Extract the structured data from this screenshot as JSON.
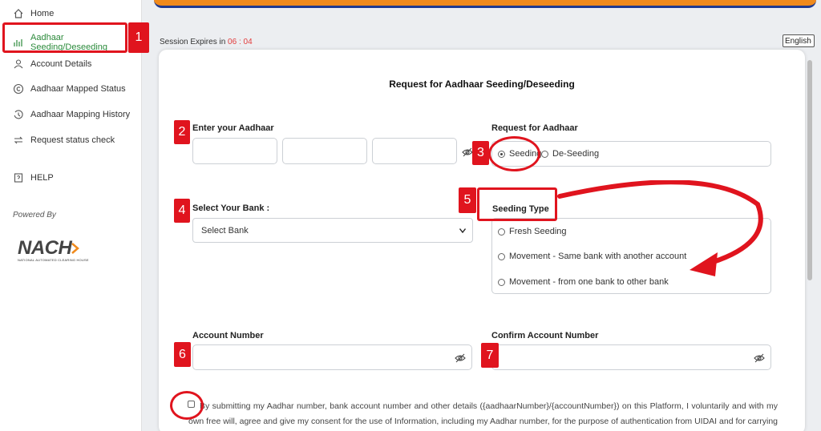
{
  "sidebar": {
    "items": [
      {
        "label": "Home",
        "icon": "home-icon"
      },
      {
        "label": "Aadhaar Seeding/Deseeding",
        "icon": "seeding-icon"
      },
      {
        "label": "Account Details",
        "icon": "account-icon"
      },
      {
        "label": "Aadhaar Mapped Status",
        "icon": "copyright-icon"
      },
      {
        "label": "Aadhaar Mapping History",
        "icon": "history-icon"
      },
      {
        "label": "Request status check",
        "icon": "transfer-icon"
      },
      {
        "label": "HELP",
        "icon": "help-icon"
      }
    ],
    "powered_by": "Powered By",
    "logo_text": "NACH",
    "logo_tagline": "NATIONAL AUTOMATED CLEARING HOUSE"
  },
  "session": {
    "label": "Session Expires in",
    "timer": "06 : 04"
  },
  "language": {
    "selected": "English"
  },
  "form": {
    "title": "Request for Aadhaar Seeding/Deseeding",
    "aadhaar_label": "Enter your Aadhaar",
    "request_label": "Request for Aadhaar",
    "request_options": [
      "Seeding",
      "De-Seeding"
    ],
    "bank_label": "Select Your Bank :",
    "bank_placeholder": "Select Bank",
    "seeding_type_label": "Seeding Type",
    "seeding_types": [
      "Fresh Seeding",
      "Movement - Same bank with another account",
      "Movement - from one bank to other bank"
    ],
    "account_label": "Account Number",
    "confirm_account_label": "Confirm Account Number",
    "consent_text": "By submitting my Aadhar number, bank account number and other details ({aadhaarNumber}/{accountNumber}) on this Platform, I voluntarily and with my own free will, agree and give my consent for the use of Information, including my Aadhar number, for the purpose of authentication from UIDAI and for carrying out seeding enquiry or"
  },
  "annotations": [
    "1",
    "2",
    "3",
    "4",
    "5",
    "6",
    "7"
  ],
  "colors": {
    "accent_red": "#e0141e",
    "active_green": "#2c8a3b",
    "topbar_orange": "#f08a1c",
    "topbar_blue": "#203a8f"
  }
}
